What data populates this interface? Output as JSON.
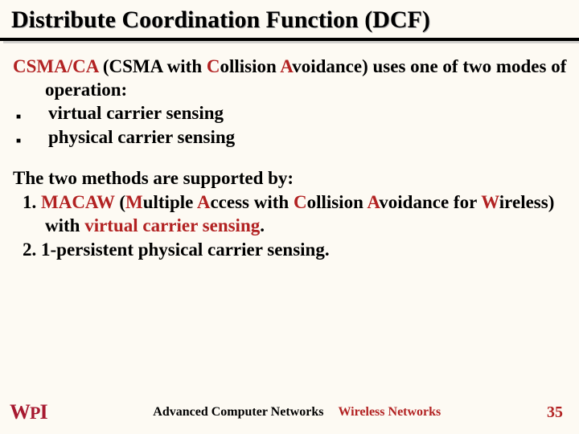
{
  "title": "Distribute Coordination Function (DCF)",
  "intro": {
    "csma_ca": "CSMA/CA",
    "rest1": " (CSMA with ",
    "c": "C",
    "rest2": "ollision ",
    "a": "A",
    "rest3": "voidance) uses one of two modes of operation:"
  },
  "bullets": [
    "virtual carrier sensing",
    "physical carrier sensing"
  ],
  "supported_intro": "The two methods are supported by:",
  "item1": {
    "num": "1. ",
    "macaw": "MACAW",
    "a1": " (",
    "m": "M",
    "a2": "ultiple ",
    "a": "A",
    "a3": "ccess with ",
    "c": "C",
    "a4": "ollision ",
    "av": "A",
    "a5": "voidance for ",
    "w": "W",
    "a6": "ireless) with ",
    "vcs": "virtual carrier sensing",
    "dot": "."
  },
  "item2": "2. 1-persistent physical carrier sensing.",
  "footer": {
    "course": "Advanced Computer Networks",
    "topic": "Wireless Networks",
    "page": "35"
  },
  "logo": {
    "w": "W",
    "p": "P",
    "i": "I"
  }
}
